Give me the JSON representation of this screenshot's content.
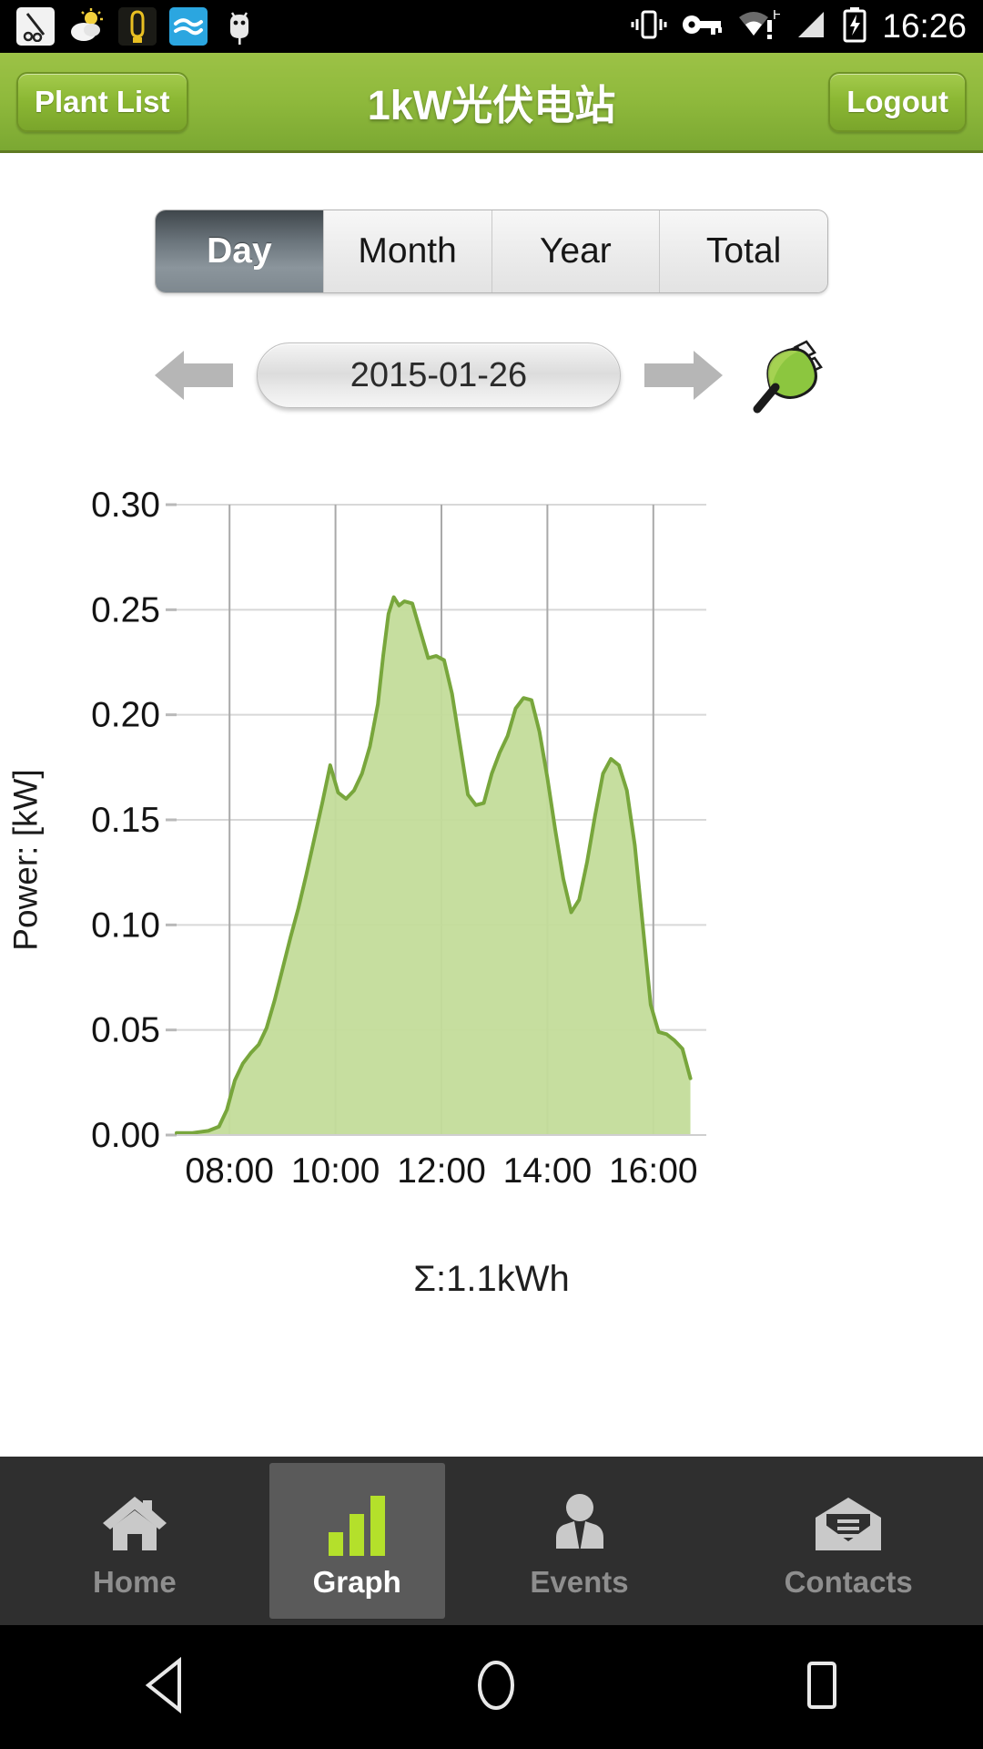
{
  "status_bar": {
    "clock": "16:26",
    "left_icons": [
      "scissors-app-icon",
      "weather-app-icon",
      "amber-app-icon",
      "wind-app-icon",
      "android-debug-icon"
    ],
    "right_icons": [
      "vibrate-icon",
      "vpn-key-icon",
      "wifi-warning-icon",
      "signal-h-icon",
      "battery-charging-icon"
    ]
  },
  "header": {
    "plant_list_label": "Plant List",
    "title": "1kW光伏电站",
    "logout_label": "Logout",
    "accent_green": "#8fb93c"
  },
  "period_tabs": {
    "items": [
      {
        "label": "Day",
        "selected": true
      },
      {
        "label": "Month",
        "selected": false
      },
      {
        "label": "Year",
        "selected": false
      },
      {
        "label": "Total",
        "selected": false
      }
    ]
  },
  "date_nav": {
    "prev_icon": "arrow-left-icon",
    "date": "2015-01-26",
    "next_icon": "arrow-right-icon",
    "plug_icon": "leaf-plug-icon"
  },
  "summary": {
    "text": "Σ:1.1kWh"
  },
  "bottom_nav": {
    "items": [
      {
        "label": "Home",
        "icon": "home-icon",
        "selected": false
      },
      {
        "label": "Graph",
        "icon": "bar-chart-icon",
        "selected": true
      },
      {
        "label": "Events",
        "icon": "person-tie-icon",
        "selected": false
      },
      {
        "label": "Contacts",
        "icon": "open-envelope-icon",
        "selected": false
      }
    ]
  },
  "system_nav": {
    "back_icon": "triangle-back-icon",
    "home_icon": "circle-home-icon",
    "recents_icon": "square-recents-icon"
  },
  "chart_data": {
    "type": "area",
    "title": "",
    "xlabel": "",
    "ylabel": "Power: [kW]",
    "ytick_labels": [
      "0.00",
      "0.05",
      "0.10",
      "0.15",
      "0.20",
      "0.25",
      "0.30"
    ],
    "ytick_values": [
      0.0,
      0.05,
      0.1,
      0.15,
      0.2,
      0.25,
      0.3
    ],
    "ylim": [
      0.0,
      0.3
    ],
    "xtick_labels": [
      "08:00",
      "10:00",
      "12:00",
      "14:00",
      "16:00"
    ],
    "xtick_values": [
      8.0,
      10.0,
      12.0,
      14.0,
      16.0
    ],
    "xlim": [
      7.0,
      17.0
    ],
    "grid": true,
    "legend": "none",
    "series_color_line": "#78a63c",
    "series_color_fill": "#c3dc9a",
    "series": [
      {
        "name": "Power",
        "x": [
          7.0,
          7.3,
          7.6,
          7.8,
          7.95,
          8.1,
          8.25,
          8.4,
          8.55,
          8.7,
          8.85,
          9.0,
          9.15,
          9.3,
          9.45,
          9.6,
          9.75,
          9.9,
          10.05,
          10.2,
          10.35,
          10.5,
          10.65,
          10.8,
          10.9,
          11.0,
          11.1,
          11.2,
          11.3,
          11.45,
          11.6,
          11.75,
          11.9,
          12.05,
          12.2,
          12.35,
          12.5,
          12.65,
          12.8,
          12.95,
          13.1,
          13.25,
          13.4,
          13.55,
          13.7,
          13.85,
          14.0,
          14.15,
          14.3,
          14.45,
          14.6,
          14.75,
          14.9,
          15.05,
          15.2,
          15.35,
          15.5,
          15.65,
          15.8,
          15.95,
          16.1,
          16.25,
          16.4,
          16.55,
          16.7
        ],
        "y": [
          0.001,
          0.001,
          0.002,
          0.004,
          0.012,
          0.026,
          0.034,
          0.039,
          0.043,
          0.051,
          0.064,
          0.079,
          0.094,
          0.108,
          0.124,
          0.141,
          0.158,
          0.176,
          0.163,
          0.16,
          0.164,
          0.172,
          0.185,
          0.205,
          0.228,
          0.248,
          0.256,
          0.252,
          0.254,
          0.253,
          0.24,
          0.227,
          0.228,
          0.226,
          0.21,
          0.186,
          0.162,
          0.157,
          0.158,
          0.172,
          0.182,
          0.19,
          0.203,
          0.208,
          0.207,
          0.192,
          0.17,
          0.145,
          0.122,
          0.106,
          0.112,
          0.13,
          0.152,
          0.172,
          0.179,
          0.176,
          0.164,
          0.138,
          0.1,
          0.062,
          0.049,
          0.048,
          0.045,
          0.041,
          0.027
        ]
      }
    ]
  }
}
